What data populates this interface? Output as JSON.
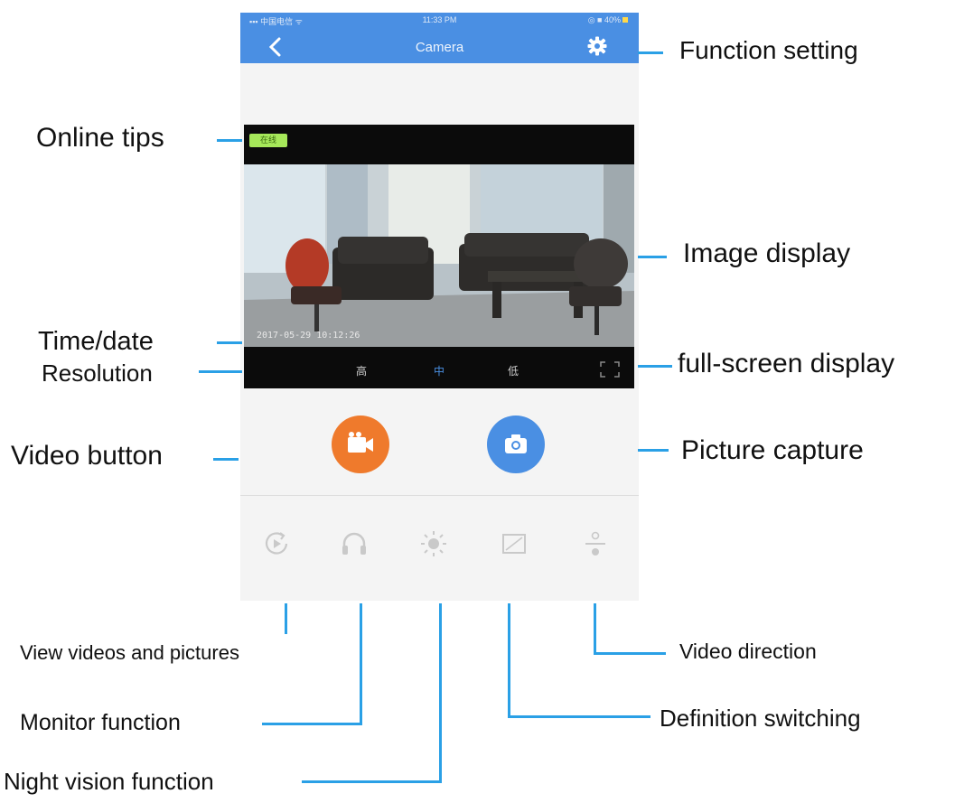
{
  "status_bar": {
    "carrier": "中国电信",
    "time": "11:33 PM",
    "battery": "40%"
  },
  "header": {
    "title": "Camera"
  },
  "video": {
    "online_badge": "在线",
    "timestamp": "2017-05-29 10:12:26",
    "resolutions": [
      "高",
      "中",
      "低"
    ],
    "active_resolution": "中"
  },
  "icons": {
    "back": "back-chevron-icon",
    "settings": "gear-icon",
    "fullscreen": "fullscreen-icon",
    "record": "video-camera-icon",
    "capture": "camera-icon",
    "playback": "replay-icon",
    "monitor": "headphones-icon",
    "night_vision": "sun-icon",
    "definition": "frame-icon",
    "direction": "flip-icon"
  },
  "colors": {
    "accent": "#4a8fe3",
    "record": "#ef7a2c",
    "annotation_line": "#2aa0e6",
    "icon_grey": "#c9c9c9"
  },
  "annotations": {
    "function_setting": "Function setting",
    "online_tips": "Online tips",
    "image_display": "Image display",
    "time_date": "Time/date",
    "resolution": "Resolution",
    "full_screen": "full-screen display",
    "video_button": "Video button",
    "picture_capture": "Picture capture",
    "view_videos": "View videos and pictures",
    "monitor_function": "Monitor function",
    "night_vision": "Night vision function",
    "video_direction": "Video direction",
    "definition_switching": "Definition switching"
  }
}
